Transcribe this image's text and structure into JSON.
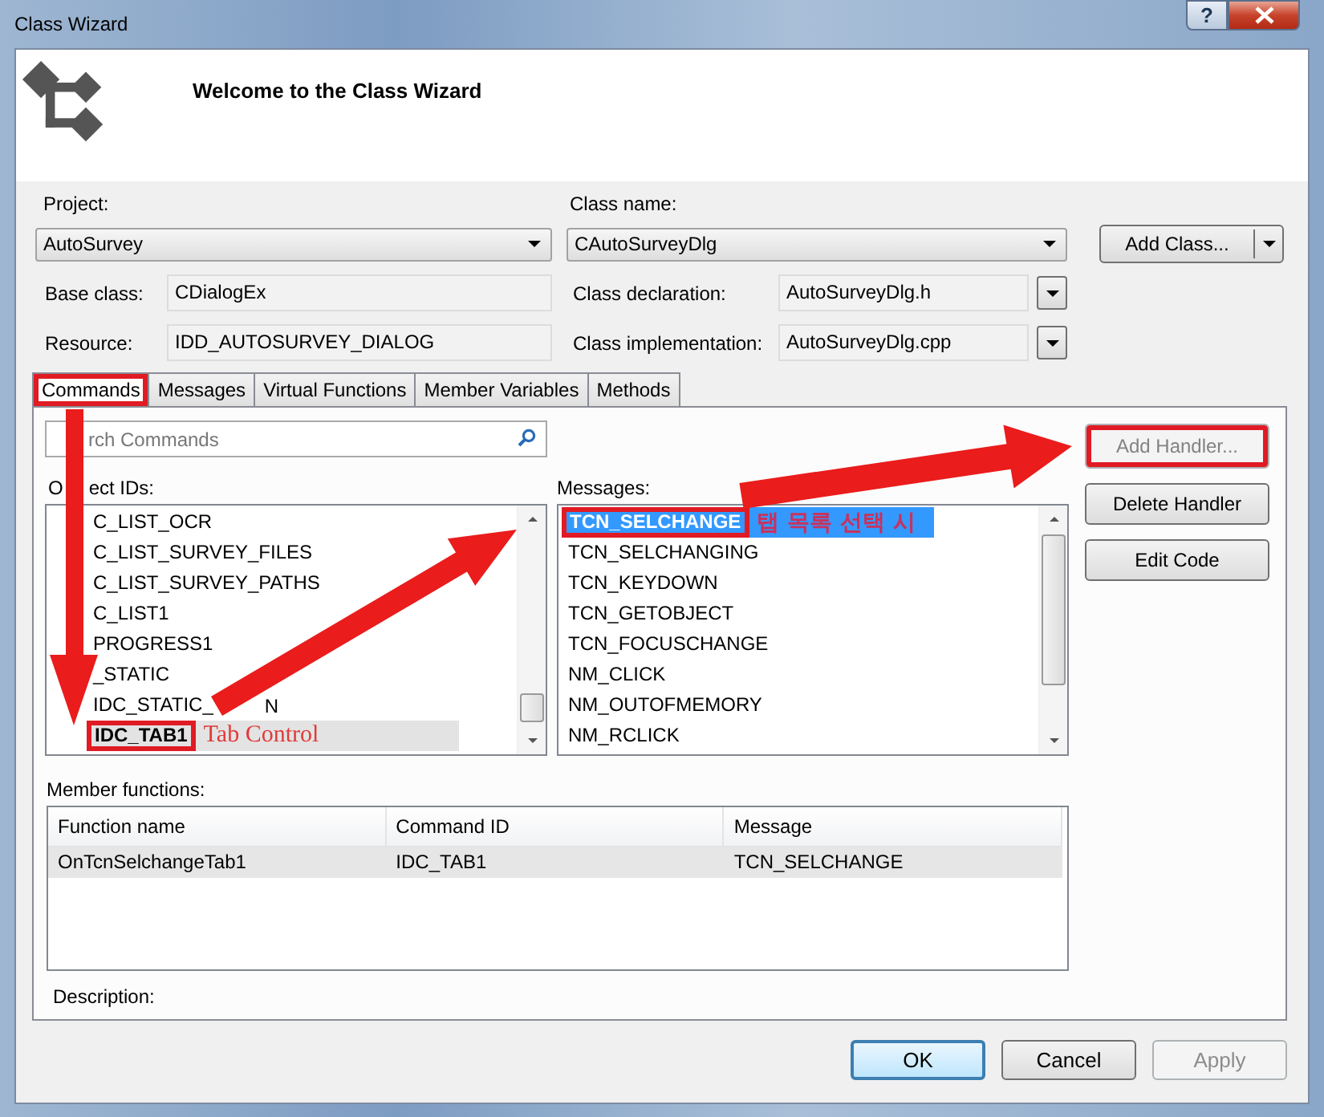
{
  "window": {
    "title": "Class Wizard",
    "help_label": "?"
  },
  "header": {
    "title": "Welcome to the Class Wizard"
  },
  "project": {
    "label": "Project:",
    "value": "AutoSurvey"
  },
  "class_name": {
    "label": "Class name:",
    "value": "CAutoSurveyDlg"
  },
  "add_class_button": {
    "label": "Add Class..."
  },
  "base_class": {
    "label": "Base class:",
    "value": "CDialogEx"
  },
  "resource": {
    "label": "Resource:",
    "value": "IDD_AUTOSURVEY_DIALOG"
  },
  "class_declaration": {
    "label": "Class declaration:",
    "value": "AutoSurveyDlg.h"
  },
  "class_implementation": {
    "label": "Class implementation:",
    "value": "AutoSurveyDlg.cpp"
  },
  "tabs": [
    {
      "label": "Commands",
      "selected": true,
      "highlighted": true
    },
    {
      "label": "Messages",
      "selected": false,
      "highlighted": false
    },
    {
      "label": "Virtual Functions",
      "selected": false,
      "highlighted": false
    },
    {
      "label": "Member Variables",
      "selected": false,
      "highlighted": false
    },
    {
      "label": "Methods",
      "selected": false,
      "highlighted": false
    }
  ],
  "commands": {
    "search": {
      "placeholder": "rch Commands"
    },
    "object_ids": {
      "label_head": "O",
      "label": "ect IDs:",
      "focused": false,
      "items": [
        {
          "text": "C_LIST_OCR",
          "selected": false,
          "highlighted": false
        },
        {
          "text": "C_LIST_SURVEY_FILES",
          "selected": false,
          "highlighted": false
        },
        {
          "text": "C_LIST_SURVEY_PATHS",
          "selected": false,
          "highlighted": false
        },
        {
          "text": "C_LIST1",
          "selected": false,
          "highlighted": false
        },
        {
          "text": "PROGRESS1",
          "selected": false,
          "highlighted": false
        },
        {
          "text": "_STATIC",
          "selected": false,
          "highlighted": false
        },
        {
          "text": "IDC_STATIC_",
          "tail": "N",
          "selected": false,
          "highlighted": false
        },
        {
          "text": "IDC_TAB1",
          "note": "Tab Control",
          "selected": true,
          "highlighted": true
        }
      ]
    },
    "messages": {
      "label": "Messages:",
      "focused": true,
      "items": [
        {
          "text": "TCN_SELCHANGE",
          "note": "탭 목록 선택 시",
          "selected": true,
          "highlighted": true
        },
        {
          "text": "TCN_SELCHANGING",
          "selected": false,
          "highlighted": false
        },
        {
          "text": "TCN_KEYDOWN",
          "selected": false,
          "highlighted": false
        },
        {
          "text": "TCN_GETOBJECT",
          "selected": false,
          "highlighted": false
        },
        {
          "text": "TCN_FOCUSCHANGE",
          "selected": false,
          "highlighted": false
        },
        {
          "text": "NM_CLICK",
          "selected": false,
          "highlighted": false
        },
        {
          "text": "NM_OUTOFMEMORY",
          "selected": false,
          "highlighted": false
        },
        {
          "text": "NM_RCLICK",
          "selected": false,
          "highlighted": false
        }
      ]
    },
    "buttons": [
      {
        "label": "Add Handler...",
        "disabled": true,
        "highlighted": true
      },
      {
        "label": "Delete Handler",
        "disabled": false,
        "highlighted": false
      },
      {
        "label": "Edit Code",
        "disabled": false,
        "highlighted": false
      }
    ],
    "member_functions": {
      "label": "Member functions:",
      "columns": [
        "Function name",
        "Command ID",
        "Message"
      ],
      "rows": [
        {
          "cells": [
            "OnTcnSelchangeTab1",
            "IDC_TAB1",
            "TCN_SELCHANGE"
          ],
          "selected": true
        }
      ]
    },
    "description": {
      "label": "Description:"
    }
  },
  "dialog_buttons": [
    {
      "label": "OK",
      "default": true,
      "disabled": false
    },
    {
      "label": "Cancel",
      "default": false,
      "disabled": false
    },
    {
      "label": "Apply",
      "default": false,
      "disabled": true
    }
  ]
}
